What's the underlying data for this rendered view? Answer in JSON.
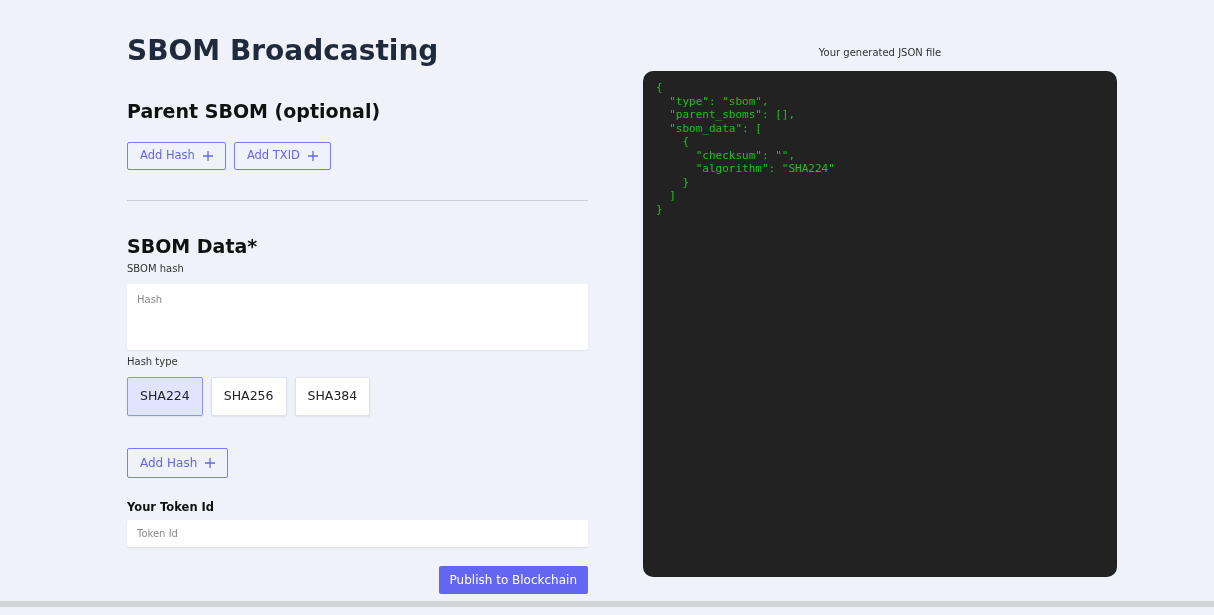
{
  "title": "SBOM Broadcasting",
  "parent_section": {
    "heading": "Parent SBOM (optional)",
    "buttons": [
      {
        "label": "Add Hash"
      },
      {
        "label": "Add TXID"
      }
    ]
  },
  "data_section": {
    "heading": "SBOM Data*",
    "hash_label": "SBOM hash",
    "hash_field": {
      "placeholder": "Hash"
    },
    "hash_type_label": "Hash type",
    "hash_types": [
      {
        "label": "SHA224",
        "selected": true
      },
      {
        "label": "SHA256",
        "selected": false
      },
      {
        "label": "SHA384",
        "selected": false
      }
    ],
    "add_button": {
      "label": "Add Hash"
    }
  },
  "token": {
    "label": "Your Token Id",
    "placeholder": "Token Id"
  },
  "publish_button": {
    "label": "Publish to Blockchain"
  },
  "preview": {
    "caption": "Your generated JSON file",
    "code_lines": [
      "{",
      "  \"type\": \"sbom\",",
      "  \"parent_sboms\": [],",
      "  \"sbom_data\": [",
      "    {",
      "      \"checksum\": \"\",",
      "      \"algorithm\": \"SHA224\"",
      "    }",
      "  ]",
      "}"
    ]
  }
}
